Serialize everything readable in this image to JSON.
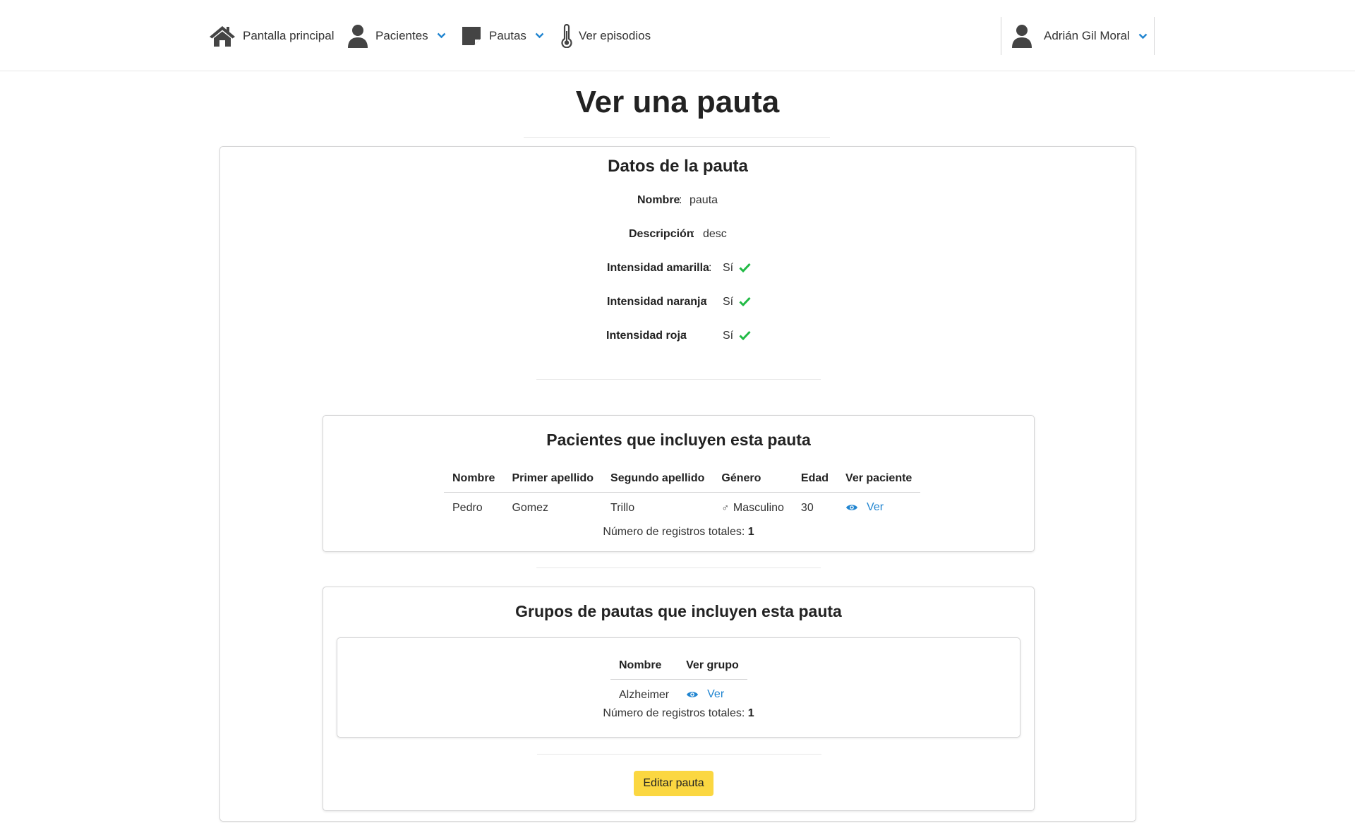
{
  "nav": {
    "home_label": "Pantalla principal",
    "patients_label": "Pacientes",
    "guidelines_label": "Pautas",
    "episodes_label": "Ver episodios",
    "user_name": "Adrián Gil Moral"
  },
  "page": {
    "title": "Ver una pauta"
  },
  "details": {
    "title": "Datos de la pauta",
    "name_label": "Nombre",
    "name_sep": ":",
    "name_value": "pauta",
    "description_label": "Descripción",
    "description_sep": ":",
    "description_value": "desc",
    "yellow_label": "Intensidad amarilla",
    "yellow_sep": ":",
    "yellow_value": "Sí",
    "orange_label": "Intensidad naranja",
    "orange_sep": ":",
    "orange_value": "Sí",
    "red_label": "Intensidad roja",
    "red_sep": ":",
    "red_value": "Sí"
  },
  "patients": {
    "title": "Pacientes que incluyen esta pauta",
    "columns": [
      "Nombre",
      "Primer apellido",
      "Segundo apellido",
      "Género",
      "Edad",
      "Ver paciente"
    ],
    "rows": [
      {
        "nombre": "Pedro",
        "apellido1": "Gomez",
        "apellido2": "Trillo",
        "genero": "Masculino",
        "genero_symbol": "♂",
        "edad": "30",
        "ver": "Ver"
      }
    ],
    "total_label": "Número de registros totales:",
    "total_value": "1"
  },
  "groups": {
    "title": "Grupos de pautas que incluyen esta pauta",
    "columns": [
      "Nombre",
      "Ver grupo"
    ],
    "rows": [
      {
        "nombre": "Alzheimer",
        "ver": "Ver"
      }
    ],
    "total_label": "Número de registros totales:",
    "total_value": "1",
    "edit_button": "Editar pauta"
  },
  "colors": {
    "accent": "#2185d0",
    "check": "#21ba45",
    "button": "#fbd741"
  }
}
